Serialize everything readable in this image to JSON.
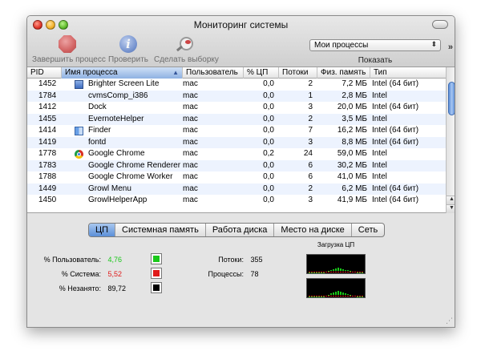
{
  "window": {
    "title": "Мониторинг системы"
  },
  "toolbar": {
    "quit_label": "Завершить процесс",
    "inspect_label": "Проверить",
    "sample_label": "Сделать выборку",
    "filter_value": "Мои процессы",
    "show_label": "Показать"
  },
  "table": {
    "headers": [
      "PID",
      "Имя процесса",
      "Пользователь",
      "% ЦП",
      "Потоки",
      "Физ. память",
      "Тип"
    ],
    "rows": [
      {
        "pid": "1452",
        "name": "Brighter Screen Lite",
        "icon": "brighter-screen-icon",
        "user": "mac",
        "cpu": "0,0",
        "threads": "2",
        "mem": "7,2 МБ",
        "type": "Intel (64 бит)"
      },
      {
        "pid": "1784",
        "name": "cvmsComp_i386",
        "icon": "",
        "user": "mac",
        "cpu": "0,0",
        "threads": "1",
        "mem": "2,8 МБ",
        "type": "Intel"
      },
      {
        "pid": "1412",
        "name": "Dock",
        "icon": "",
        "user": "mac",
        "cpu": "0,0",
        "threads": "3",
        "mem": "20,0 МБ",
        "type": "Intel (64 бит)"
      },
      {
        "pid": "1455",
        "name": "EvernoteHelper",
        "icon": "",
        "user": "mac",
        "cpu": "0,0",
        "threads": "2",
        "mem": "3,5 МБ",
        "type": "Intel"
      },
      {
        "pid": "1414",
        "name": "Finder",
        "icon": "finder-icon",
        "user": "mac",
        "cpu": "0,0",
        "threads": "7",
        "mem": "16,2 МБ",
        "type": "Intel (64 бит)"
      },
      {
        "pid": "1419",
        "name": "fontd",
        "icon": "",
        "user": "mac",
        "cpu": "0,0",
        "threads": "3",
        "mem": "8,8 МБ",
        "type": "Intel (64 бит)"
      },
      {
        "pid": "1778",
        "name": "Google Chrome",
        "icon": "chrome-icon",
        "user": "mac",
        "cpu": "0,2",
        "threads": "24",
        "mem": "59,0 МБ",
        "type": "Intel"
      },
      {
        "pid": "1783",
        "name": "Google Chrome Renderer",
        "icon": "",
        "user": "mac",
        "cpu": "0,0",
        "threads": "6",
        "mem": "30,2 МБ",
        "type": "Intel"
      },
      {
        "pid": "1788",
        "name": "Google Chrome Worker",
        "icon": "",
        "user": "mac",
        "cpu": "0,0",
        "threads": "6",
        "mem": "41,0 МБ",
        "type": "Intel"
      },
      {
        "pid": "1449",
        "name": "Growl Menu",
        "icon": "",
        "user": "mac",
        "cpu": "0,0",
        "threads": "2",
        "mem": "6,2 МБ",
        "type": "Intel (64 бит)"
      },
      {
        "pid": "1450",
        "name": "GrowlHelperApp",
        "icon": "",
        "user": "mac",
        "cpu": "0,0",
        "threads": "3",
        "mem": "41,9 МБ",
        "type": "Intel (64 бит)"
      }
    ]
  },
  "tabs": [
    {
      "label": "ЦП",
      "active": true
    },
    {
      "label": "Системная память",
      "active": false
    },
    {
      "label": "Работа диска",
      "active": false
    },
    {
      "label": "Место на диске",
      "active": false
    },
    {
      "label": "Сеть",
      "active": false
    }
  ],
  "cpu": {
    "user_label": "% Пользователь:",
    "user_value": "4,76",
    "user_color": "#19c819",
    "system_label": "% Система:",
    "system_value": "5,52",
    "system_color": "#e01a1a",
    "idle_label": "% Незанято:",
    "idle_value": "89,72",
    "idle_color": "#000000",
    "threads_label": "Потоки:",
    "threads_value": "355",
    "processes_label": "Процессы:",
    "processes_value": "78",
    "chart_title": "Загрузка ЦП"
  }
}
